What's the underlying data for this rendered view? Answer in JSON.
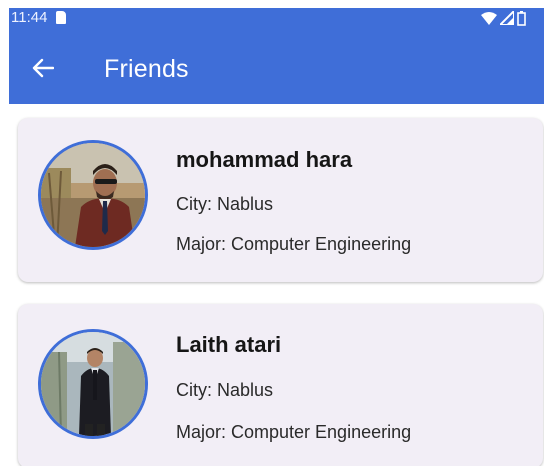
{
  "status_bar": {
    "time": "11:44",
    "icons": [
      "sim-card-icon",
      "wifi-icon",
      "signal-icon",
      "battery-icon"
    ]
  },
  "app_bar": {
    "back_icon": "arrow-back-icon",
    "title": "Friends",
    "color": "#3f6ed8"
  },
  "friends": [
    {
      "name": "mohammad hara",
      "city": "City: Nablus",
      "major": "Major: Computer Engineering"
    },
    {
      "name": "Laith atari",
      "city": "City: Nablus",
      "major": "Major: Computer Engineering"
    }
  ],
  "colors": {
    "primary": "#3f6ed8",
    "card_background": "#f2eef6",
    "avatar_border": "#3f6ed8"
  }
}
